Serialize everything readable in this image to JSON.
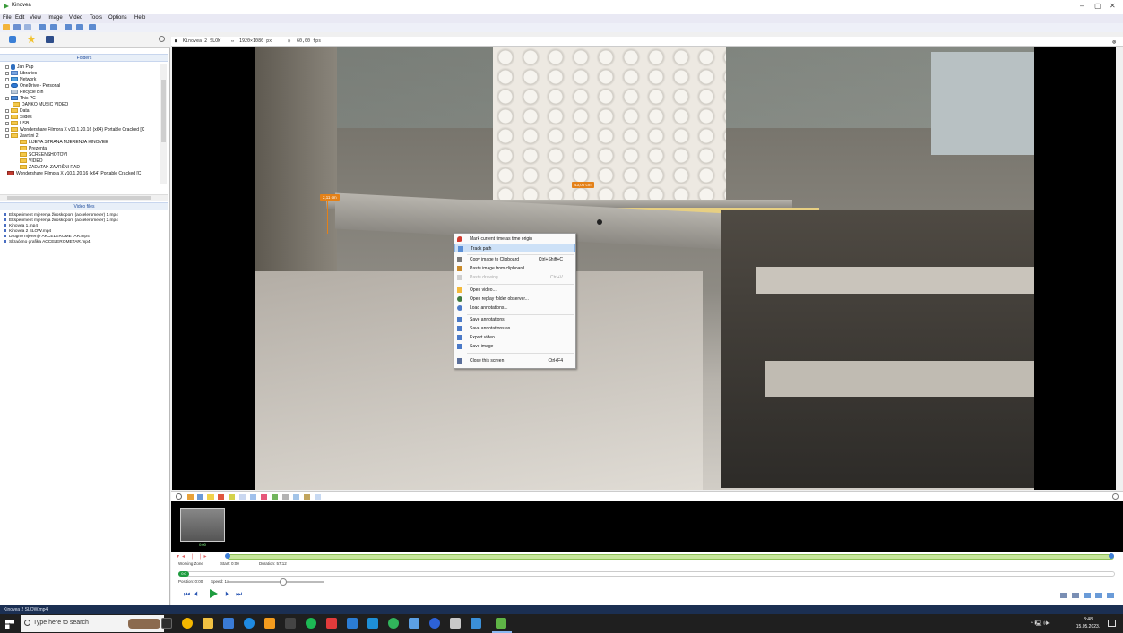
{
  "window": {
    "title": "Kinovea",
    "controls": {
      "minimize": "–",
      "maximize": "▢",
      "close": "✕"
    }
  },
  "menu": [
    "File",
    "Edit",
    "View",
    "Image",
    "Video",
    "Tools",
    "Options",
    "Help"
  ],
  "left_panel": {
    "folders_header": "Folders",
    "folders": [
      {
        "label": "Jan Pap",
        "indent": 1
      },
      {
        "label": "Libraries",
        "indent": 1
      },
      {
        "label": "Network",
        "indent": 1
      },
      {
        "label": "OneDrive - Personal",
        "indent": 1
      },
      {
        "label": "Recycle Bin",
        "indent": 1
      },
      {
        "label": "This PC",
        "indent": 1
      },
      {
        "label": "DANKO MUSIC VIDEO",
        "indent": 2
      },
      {
        "label": "Data",
        "indent": 1
      },
      {
        "label": "Slides",
        "indent": 1
      },
      {
        "label": "USB",
        "indent": 1
      },
      {
        "label": "Wondershare Filmora X v10.1.20.16 (x64) Portable Cracked [C",
        "indent": 1
      },
      {
        "label": "Završni 2",
        "indent": 1
      },
      {
        "label": "LIJEVA STRANA MJERENJA KINOVEE",
        "indent": 2
      },
      {
        "label": "Prezenta",
        "indent": 2
      },
      {
        "label": "SCREENSHOTOVI",
        "indent": 2
      },
      {
        "label": "VIDEO",
        "indent": 2
      },
      {
        "label": "ZADATAK ZAVRŠNI RAD",
        "indent": 2
      },
      {
        "label": "Wondershare Filmora X v10.1.20.16 (x64) Portable Cracked [C",
        "indent": 1
      }
    ],
    "files_header": "Video files",
    "files": [
      "Eksperiment mjerenja žiroskopom (accelerometer) 1.mp4",
      "Eksperiment mjerenja žiroskopom (accelerometer) 2.mp4",
      "Kinovea 1.mp4",
      "Kinovea 2 SLOW.mp4",
      "Drugno mjerenje AKCELEROMETAR.mp4",
      "Skraćeno grafika ACCELEROMETAR.mp4"
    ]
  },
  "screen_header": {
    "filename": "Kinovea 2 SLOW",
    "resolution": "1920×1080 px",
    "fps": "60,00 fps"
  },
  "video_labels": {
    "left_measure": "2,11 cm",
    "center_measure": "43,00 cm"
  },
  "context_menu": {
    "items": [
      {
        "label": "Mark current time as time origin",
        "shortcut": "",
        "icon_color": "#d13b2f",
        "icon": "pin-icon",
        "state": "normal"
      },
      {
        "label": "Track path",
        "shortcut": "",
        "icon_color": "#5a8fd6",
        "icon": "track-path-icon",
        "state": "highlighted"
      },
      {
        "label": "Copy image to Clipboard",
        "shortcut": "Ctrl+Shift+C",
        "icon_color": "#7a7a7a",
        "icon": "copy-icon",
        "state": "normal"
      },
      {
        "label": "Paste image from clipboard",
        "shortcut": "",
        "icon_color": "#c98a2a",
        "icon": "paste-icon",
        "state": "normal"
      },
      {
        "label": "Paste drawing",
        "shortcut": "Ctrl+V",
        "icon_color": "#b9b9b9",
        "icon": "paste-drawing-icon",
        "state": "disabled"
      },
      {
        "label": "Open video...",
        "shortcut": "",
        "icon_color": "#f2b93b",
        "icon": "folder-icon",
        "state": "normal"
      },
      {
        "label": "Open replay folder observer...",
        "shortcut": "",
        "icon_color": "#3f7a3f",
        "icon": "observer-icon",
        "state": "normal"
      },
      {
        "label": "Load annotations...",
        "shortcut": "",
        "icon_color": "#4a79c7",
        "icon": "load-icon",
        "state": "normal"
      },
      {
        "label": "Save annotations",
        "shortcut": "",
        "icon_color": "#4a79c7",
        "icon": "save-icon",
        "state": "normal"
      },
      {
        "label": "Save annotations as...",
        "shortcut": "",
        "icon_color": "#4a79c7",
        "icon": "save-as-icon",
        "state": "normal"
      },
      {
        "label": "Export video...",
        "shortcut": "",
        "icon_color": "#4a79c7",
        "icon": "export-icon",
        "state": "normal"
      },
      {
        "label": "Save image",
        "shortcut": "",
        "icon_color": "#4a79c7",
        "icon": "image-icon",
        "state": "normal"
      },
      {
        "label": "Close this screen",
        "shortcut": "Ctrl+F4",
        "icon_color": "#5b6f9a",
        "icon": "close-screen-icon",
        "state": "normal"
      }
    ]
  },
  "filmstrip": {
    "thumb_label": "0:00"
  },
  "controls": {
    "working_zone": "Working Zone",
    "start": "Start: 0:00",
    "duration": "Duration: 57:12",
    "position": "Position: 0:00",
    "speed": "Speed: 1x",
    "time_badge": "0:0"
  },
  "status_bar": {
    "text": "Kinovea 2 SLOW.mp4"
  },
  "taskbar": {
    "search_placeholder": "Type here to search",
    "time": "8:48",
    "date": "15.05.2023.",
    "tray": "^ 🖳 🕪"
  }
}
